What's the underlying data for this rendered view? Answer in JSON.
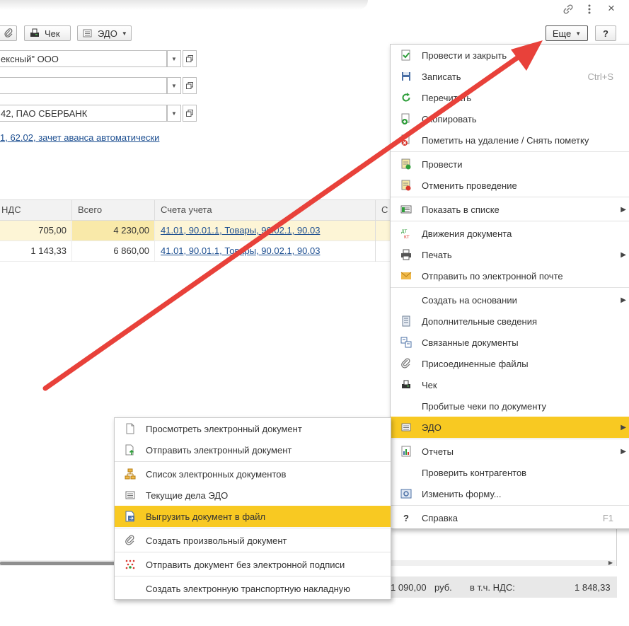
{
  "window": {
    "link_icon": "link-icon",
    "more_icon": "vertical-dots-icon",
    "close_label": "×"
  },
  "toolbar": {
    "check_label": "Чек",
    "edo_label": "ЭДО",
    "more_label": "Еще",
    "help_label": "?"
  },
  "form": {
    "counterparty": "ексный\" ООО",
    "contract": "",
    "bank_account": "42, ПАО СБЕРБАНК",
    "settlements_link": "1, 62.02, зачет аванса автоматически"
  },
  "table": {
    "columns": [
      "НДС",
      "Всего",
      "Счета учета",
      "С"
    ],
    "rows": [
      {
        "vat": "705,00",
        "total": "4 230,00",
        "accounts": "41.01, 90.01.1, Товары, 90.02.1, 90.03"
      },
      {
        "vat": "1 143,33",
        "total": "6 860,00",
        "accounts": "41.01, 90.01.1, Товары, 90.02.1, 90.03"
      }
    ]
  },
  "footer": {
    "total_amount": "1 090,00",
    "currency": "руб.",
    "vat_label": "в т.ч. НДС:",
    "vat_amount": "1 848,33"
  },
  "more_menu": {
    "items": [
      {
        "label": "Провести и закрыть",
        "shortcut": "",
        "icon": "post-and-close-icon"
      },
      {
        "label": "Записать",
        "shortcut": "Ctrl+S",
        "icon": "save-icon"
      },
      {
        "label": "Перечитать",
        "shortcut": "",
        "icon": "refresh-icon"
      },
      {
        "label": "Скопировать",
        "shortcut": "",
        "icon": "copy-icon"
      },
      {
        "label": "Пометить на удаление / Снять пометку",
        "shortcut": "",
        "icon": "delete-mark-icon"
      },
      {
        "label": "Провести",
        "shortcut": "",
        "icon": "post-icon"
      },
      {
        "label": "Отменить проведение",
        "shortcut": "",
        "icon": "unpost-icon"
      },
      {
        "label": "Показать в списке",
        "shortcut": "",
        "icon": "show-in-list-icon"
      },
      {
        "label": "Движения документа",
        "shortcut": "",
        "icon": "dt-kt-icon"
      },
      {
        "label": "Печать",
        "shortcut": "",
        "icon": "print-icon"
      },
      {
        "label": "Отправить по электронной почте",
        "shortcut": "",
        "icon": "envelope-icon"
      },
      {
        "label": "Создать на основании",
        "shortcut": "",
        "icon": ""
      },
      {
        "label": "Дополнительные сведения",
        "shortcut": "",
        "icon": "details-icon"
      },
      {
        "label": "Связанные документы",
        "shortcut": "",
        "icon": "linked-docs-icon"
      },
      {
        "label": "Присоединенные файлы",
        "shortcut": "",
        "icon": "paperclip-icon"
      },
      {
        "label": "Чек",
        "shortcut": "",
        "icon": "receipt-printer-icon"
      },
      {
        "label": "Пробитые чеки по документу",
        "shortcut": "",
        "icon": ""
      },
      {
        "label": "ЭДО",
        "shortcut": "",
        "icon": "edo-icon"
      },
      {
        "label": "Отчеты",
        "shortcut": "",
        "icon": "reports-icon"
      },
      {
        "label": "Проверить контрагентов",
        "shortcut": "",
        "icon": ""
      },
      {
        "label": "Изменить форму...",
        "shortcut": "",
        "icon": "form-settings-icon"
      },
      {
        "label": "Справка",
        "shortcut": "F1",
        "icon": "help-icon"
      }
    ]
  },
  "edo_menu": {
    "items": [
      {
        "label": "Просмотреть электронный документ",
        "icon": "document-icon"
      },
      {
        "label": "Отправить электронный документ",
        "icon": "send-document-icon"
      },
      {
        "label": "Список электронных документов",
        "icon": "doc-list-icon"
      },
      {
        "label": "Текущие дела ЭДО",
        "icon": "edo-tasks-icon"
      },
      {
        "label": "Выгрузить документ в файл",
        "icon": "export-file-icon"
      },
      {
        "label": "Создать произвольный документ",
        "icon": "paperclip-icon"
      },
      {
        "label": "Отправить документ без электронной подписи",
        "icon": "unsigned-send-icon"
      },
      {
        "label": "Создать электронную транспортную накладную",
        "icon": ""
      }
    ]
  },
  "colors": {
    "highlight": "#f8c922",
    "arrow": "#e8413a",
    "selected_row": "#fdf5d6",
    "link": "#1d4f91"
  }
}
